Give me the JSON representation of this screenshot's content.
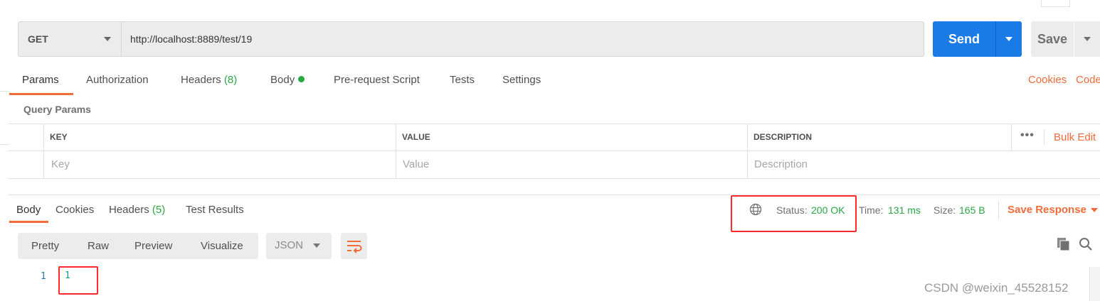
{
  "request": {
    "method": "GET",
    "url": "http://localhost:8889/test/19",
    "send_label": "Send",
    "save_label": "Save"
  },
  "request_tabs": [
    {
      "label": "Params"
    },
    {
      "label": "Authorization"
    },
    {
      "label": "Headers",
      "count": "(8)"
    },
    {
      "label": "Body"
    },
    {
      "label": "Pre-request Script"
    },
    {
      "label": "Tests"
    },
    {
      "label": "Settings"
    }
  ],
  "request_links": {
    "cookies": "Cookies",
    "code": "Code"
  },
  "query_params": {
    "title": "Query Params",
    "columns": [
      "KEY",
      "VALUE",
      "DESCRIPTION"
    ],
    "placeholders": [
      "Key",
      "Value",
      "Description"
    ],
    "more": "•••",
    "bulk_edit": "Bulk Edit"
  },
  "response_tabs": [
    {
      "label": "Body"
    },
    {
      "label": "Cookies"
    },
    {
      "label": "Headers",
      "count": "(5)"
    },
    {
      "label": "Test Results"
    }
  ],
  "response_meta": {
    "status_label": "Status:",
    "status_value": "200 OK",
    "time_label": "Time:",
    "time_value": "131 ms",
    "size_label": "Size:",
    "size_value": "165 B",
    "save_response": "Save Response"
  },
  "view_modes": [
    "Pretty",
    "Raw",
    "Preview",
    "Visualize"
  ],
  "format": "JSON",
  "body_lines": [
    {
      "no": "1",
      "text": "1"
    }
  ],
  "watermark": "CSDN @weixin_45528152",
  "colors": {
    "accent": "#f26b3a",
    "send": "#1a7ae6",
    "success": "#28a745",
    "highlight": "#ff2a2a"
  }
}
